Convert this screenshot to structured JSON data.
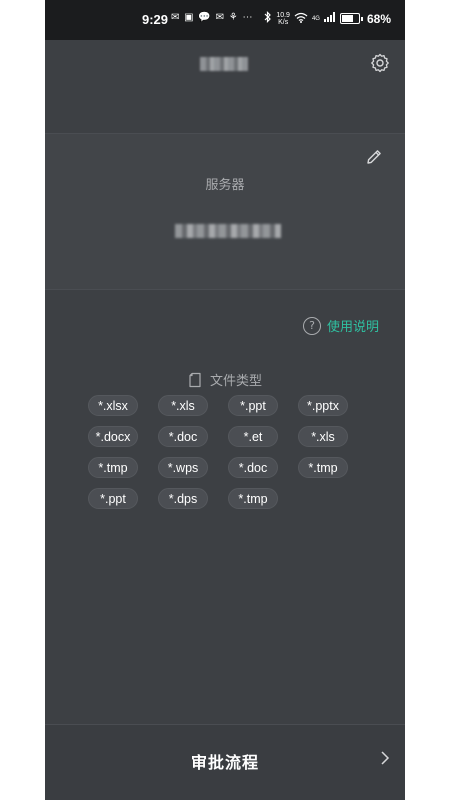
{
  "status_bar": {
    "time": "9:29",
    "notification_icons": "✉ ▣ 💬 ✉ ⚘ ⋯",
    "net_speed_top": "10.9",
    "net_speed_unit": "K/s",
    "signal_label": "4G",
    "battery_percent": "68%"
  },
  "header": {
    "settings_icon": "gear-icon"
  },
  "server_card": {
    "label": "服务器",
    "edit_icon": "pencil-icon"
  },
  "help": {
    "icon": "question-circle-icon",
    "label": "使用说明"
  },
  "file_types": {
    "title": "文件类型",
    "icon": "document-icon",
    "items": [
      "*.xlsx",
      "*.xls",
      "*.ppt",
      "*.pptx",
      "*.docx",
      "*.doc",
      "*.et",
      "*.xls",
      "*.tmp",
      "*.wps",
      "*.doc",
      "*.tmp",
      "*.ppt",
      "*.dps",
      "*.tmp"
    ]
  },
  "bottom_bar": {
    "label": "审批流程",
    "icon": "chevron-right-icon"
  },
  "colors": {
    "background": "#3d4044",
    "accent": "#2fc0a1",
    "status_bar": "#1b1c1e"
  }
}
